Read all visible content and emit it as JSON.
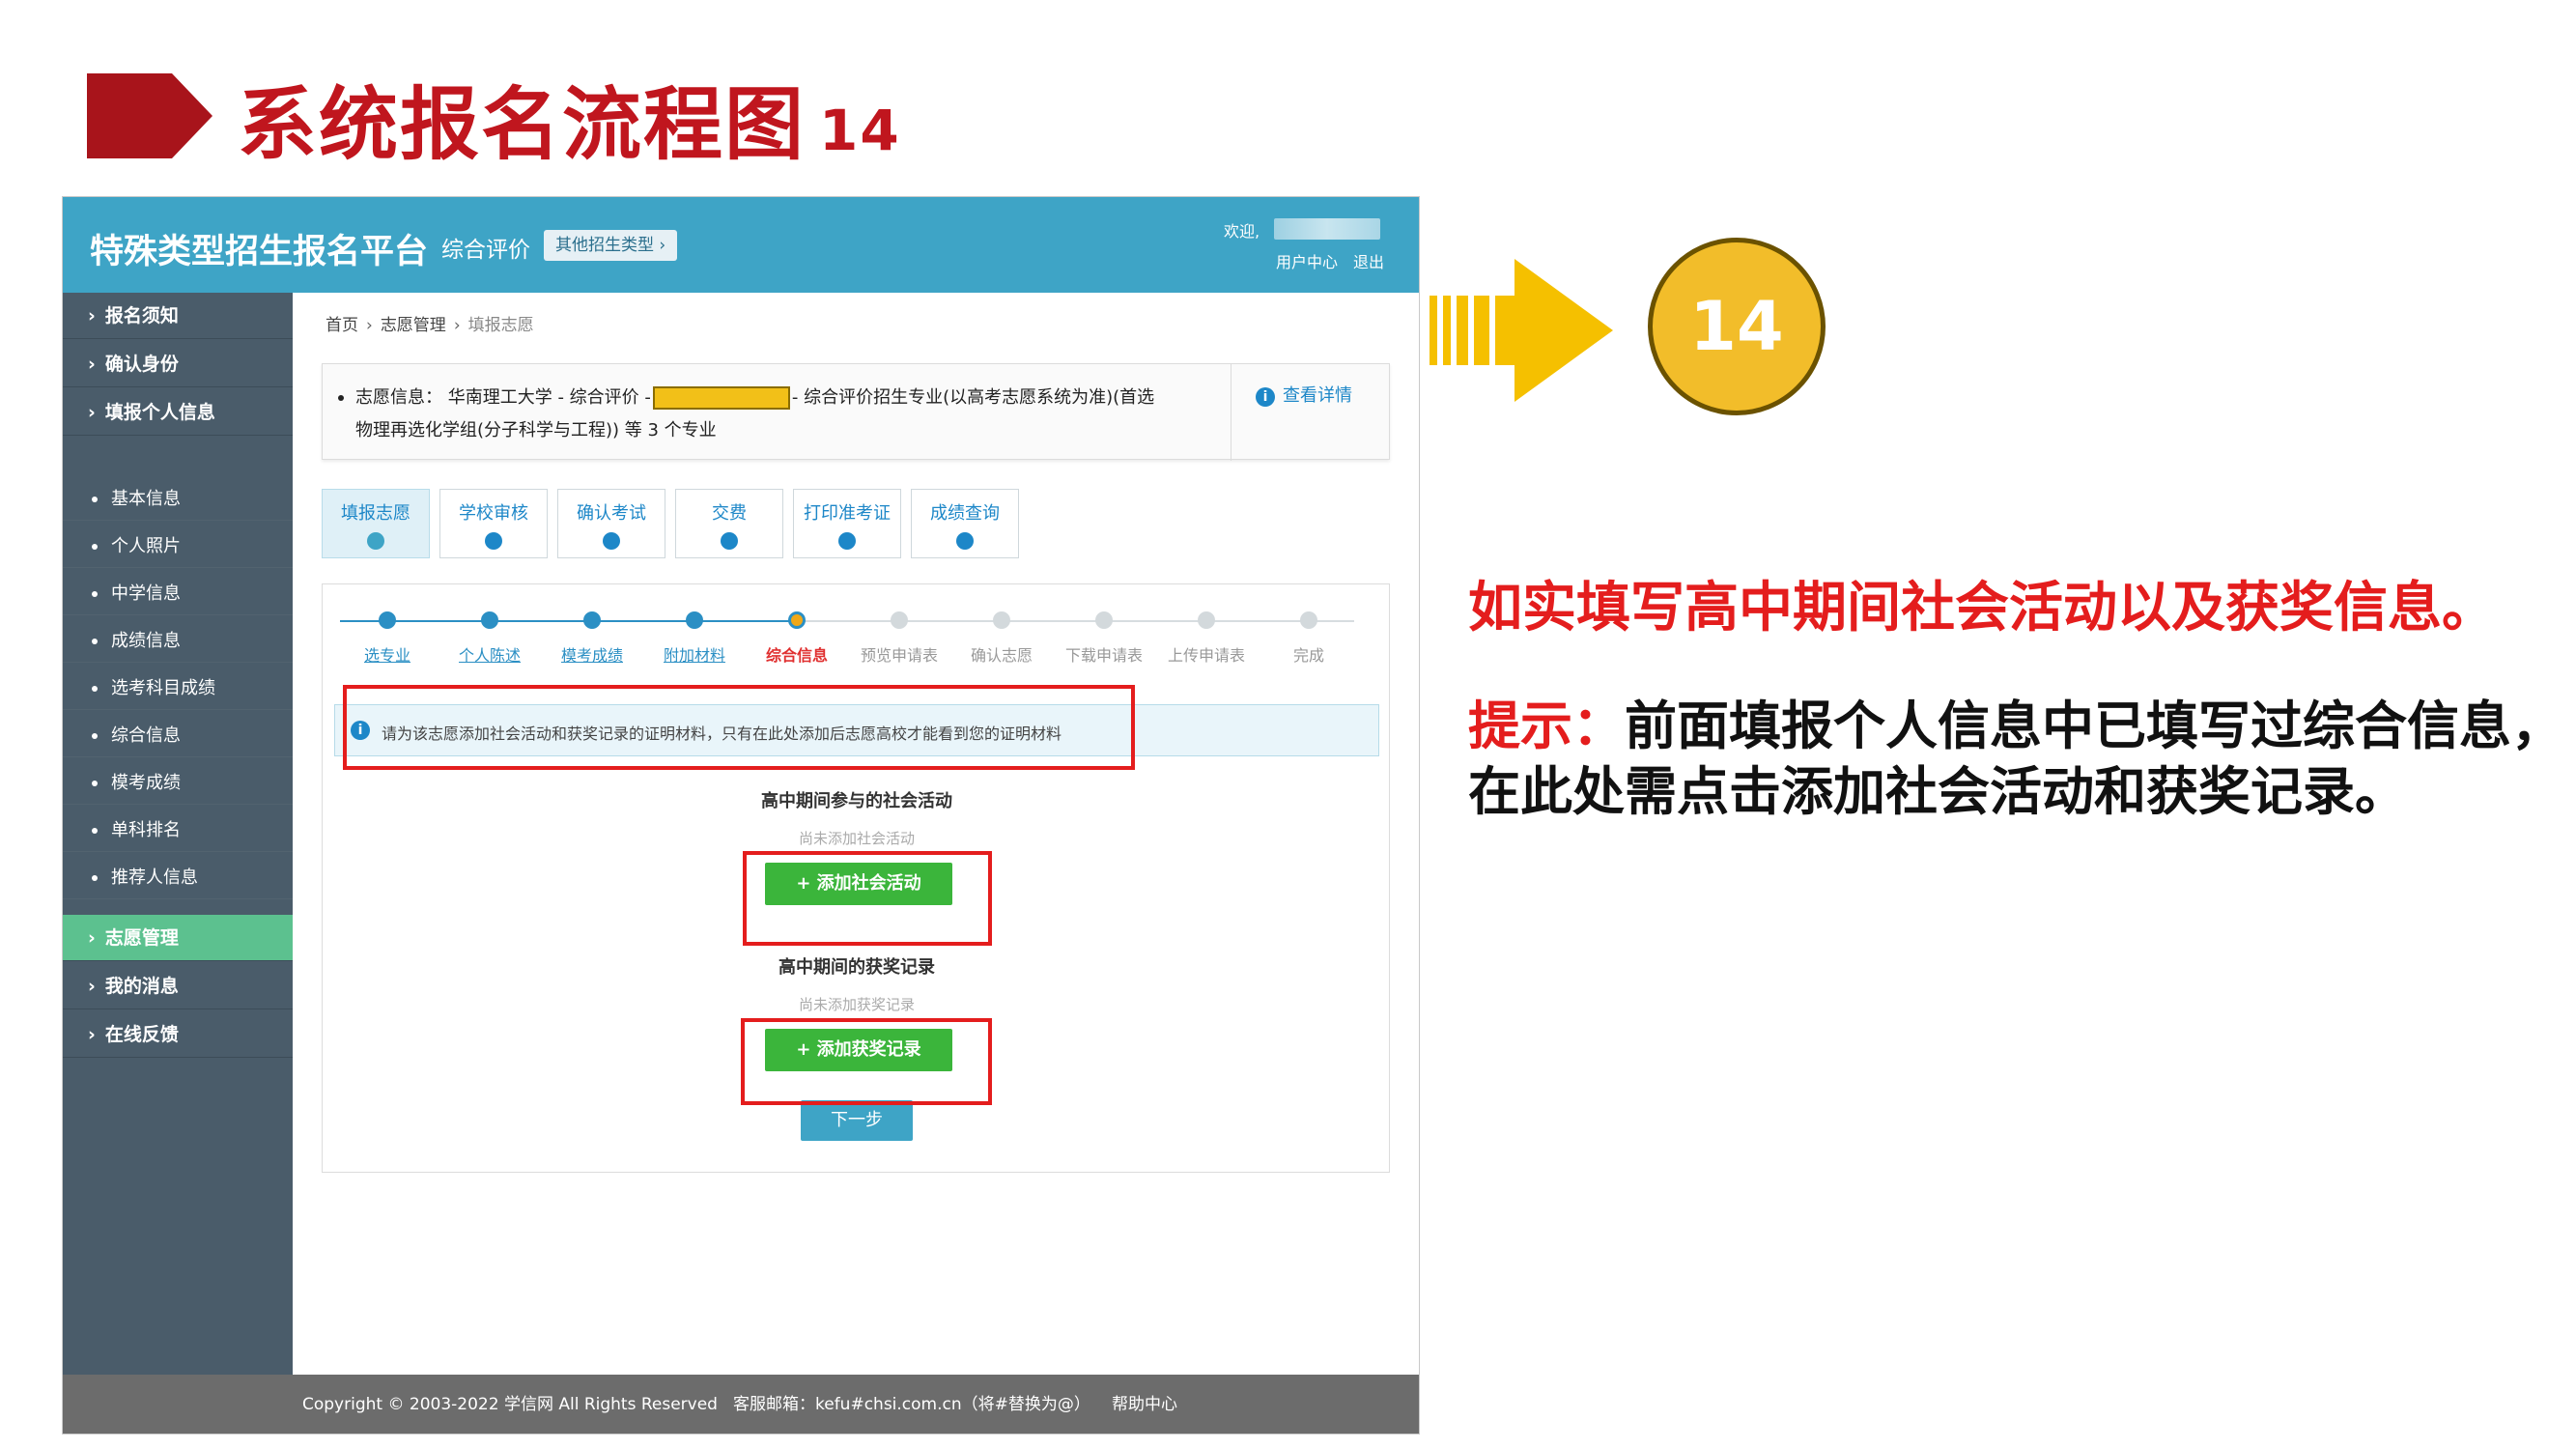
{
  "slide": {
    "title": "系统报名流程图",
    "number": "14",
    "step_badge": "14",
    "annotation_main": "如实填写高中期间社会活动以及获奖信息。",
    "hint_label": "提示：",
    "hint_line1": "前面填报个人信息中已填写过综合信息，",
    "hint_line2": "在此处需点击添加社会活动和获奖记录。",
    "colors": {
      "title": "#c0161e",
      "accent_red": "#e41d1d",
      "badge": "#f2bd2a",
      "arrow": "#f5c000"
    }
  },
  "app": {
    "brand": "特殊类型招生报名平台",
    "category": "综合评价",
    "other_types": "其他招生类型",
    "welcome": "欢迎,",
    "user_center": "用户中心",
    "logout": "退出",
    "colors": {
      "topbar": "#3ea4c6",
      "sidebar": "#4a5c6a",
      "active_nav": "#5cc18f",
      "button_green": "#3bb53b"
    }
  },
  "sidebar": {
    "main_top": [
      "报名须知",
      "确认身份",
      "填报个人信息"
    ],
    "sub_items": [
      "基本信息",
      "个人照片",
      "中学信息",
      "成绩信息",
      "选考科目成绩",
      "综合信息",
      "模考成绩",
      "单科排名",
      "推荐人信息"
    ],
    "main_bottom": [
      {
        "label": "志愿管理",
        "active": true
      },
      {
        "label": "我的消息",
        "active": false
      },
      {
        "label": "在线反馈",
        "active": false
      }
    ]
  },
  "breadcrumb": [
    "首页",
    "志愿管理",
    "填报志愿"
  ],
  "volunteer_info": {
    "label": "志愿信息：",
    "school_part": "华南理工大学 - 综合评价 -",
    "tail_part": "- 综合评价招生专业(以高考志愿系统为准)(首选",
    "line2": "物理再选化学组(分子科学与工程)) 等 3 个专业",
    "detail_link": "查看详情"
  },
  "tabs": [
    {
      "label": "填报志愿",
      "active": true
    },
    {
      "label": "学校审核",
      "active": false
    },
    {
      "label": "确认考试",
      "active": false
    },
    {
      "label": "交费",
      "active": false
    },
    {
      "label": "打印准考证",
      "active": false
    },
    {
      "label": "成绩查询",
      "active": false
    }
  ],
  "steps": [
    {
      "label": "选专业",
      "state": "done"
    },
    {
      "label": "个人陈述",
      "state": "done"
    },
    {
      "label": "模考成绩",
      "state": "done"
    },
    {
      "label": "附加材料",
      "state": "done"
    },
    {
      "label": "综合信息",
      "state": "current"
    },
    {
      "label": "预览申请表",
      "state": "todo"
    },
    {
      "label": "确认志愿",
      "state": "todo"
    },
    {
      "label": "下载申请表",
      "state": "todo"
    },
    {
      "label": "上传申请表",
      "state": "todo"
    },
    {
      "label": "完成",
      "state": "todo"
    }
  ],
  "notice": "请为该志愿添加社会活动和获奖记录的证明材料，只有在此处添加后志愿高校才能看到您的证明材料",
  "activities": {
    "title": "高中期间参与的社会活动",
    "empty": "尚未添加社会活动",
    "button": "+ 添加社会活动"
  },
  "awards": {
    "title": "高中期间的获奖记录",
    "empty": "尚未添加获奖记录",
    "button": "+ 添加获奖记录"
  },
  "next_button": "下一步",
  "footer": {
    "copyright": "Copyright © 2003-2022 学信网 All Rights Reserved",
    "email": "客服邮箱：kefu#chsi.com.cn（将#替换为@）",
    "help": "帮助中心"
  }
}
